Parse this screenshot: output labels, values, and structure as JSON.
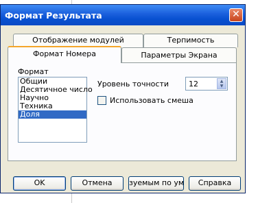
{
  "window": {
    "title": "Формат Результата",
    "close_glyph": "✕"
  },
  "tabs": [
    {
      "label": "Отображение модулей"
    },
    {
      "label": "Терпимость"
    },
    {
      "label": "Формат Номера"
    },
    {
      "label": "Параметры Экрана"
    }
  ],
  "format": {
    "group_label": "Формат",
    "items": [
      "Общии",
      "Десятичное число",
      "Научно",
      "Техника",
      "Доля"
    ],
    "selected": "Доля"
  },
  "precision": {
    "label": "Уровень точности",
    "value": "12",
    "up_glyph": "▲",
    "down_glyph": "▼"
  },
  "mixed": {
    "label": "Использовать смеша",
    "checked": false
  },
  "buttons": {
    "ok": "OK",
    "cancel": "Отмена",
    "default": "зуемым по умо",
    "help": "Справка"
  },
  "colors": {
    "titlebar": "#0a4ac5",
    "selection": "#316ac5",
    "active_tab_accent": "#f4a62a",
    "close": "#c8441c"
  }
}
